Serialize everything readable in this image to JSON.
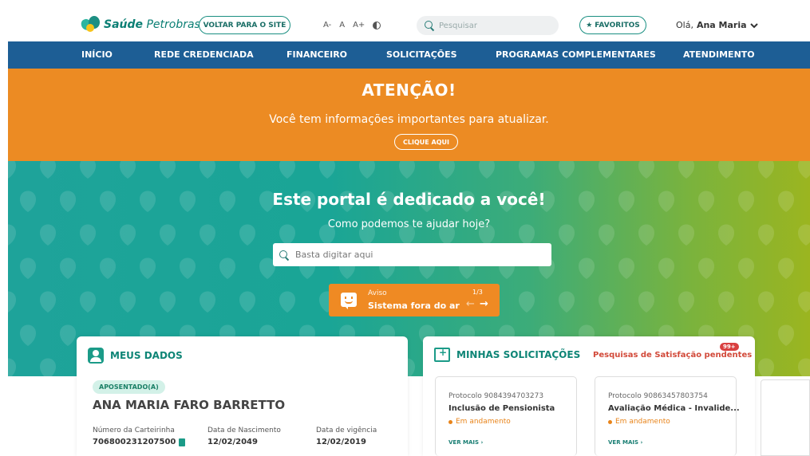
{
  "header": {
    "logo_bold": "Saúde",
    "logo_rest": "Petrobras",
    "back_button": "VOLTAR PARA O SITE",
    "font_decrease": "A-",
    "font_normal": "A",
    "font_increase": "A+",
    "search_placeholder": "Pesquisar",
    "favorites": "FAVORITOS",
    "greeting_prefix": "Olá,",
    "user_name": "Ana Maria"
  },
  "nav": {
    "items": [
      "INÍCIO",
      "REDE CREDENCIADA",
      "FINANCEIRO",
      "SOLICITAÇÕES",
      "PROGRAMAS COMPLEMENTARES",
      "ATENDIMENTO"
    ]
  },
  "alert": {
    "title": "ATENÇÃO!",
    "message": "Você tem informações importantes para atualizar.",
    "button": "CLIQUE AQUI"
  },
  "hero": {
    "title_prefix": "Este portal é dedicado a ",
    "title_emph": "você!",
    "subtitle": "Como podemos te ajudar hoje?",
    "search_placeholder": "Basta digitar aqui",
    "notice": {
      "label": "Aviso",
      "text": "Sistema fora do ar",
      "counter": "1/3"
    }
  },
  "meus_dados": {
    "title": "MEUS DADOS",
    "badge": "APOSENTADO(A)",
    "name": "ANA MARIA FARO BARRETTO",
    "fields": [
      {
        "label": "Número da Carteirinha",
        "value": "706800231207500"
      },
      {
        "label": "Data de Nascimento",
        "value": "12/02/2049"
      },
      {
        "label": "Data de vigência",
        "value": "12/02/2019"
      }
    ]
  },
  "solicitacoes": {
    "title": "MINHAS SOLICITAÇÕES",
    "survey_link": "Pesquisas de Satisfação pendentes",
    "survey_badge": "99+",
    "items": [
      {
        "protocol": "Protocolo 9084394703273",
        "title": "Inclusão de Pensionista",
        "status": "Em andamento",
        "more": "VER MAIS"
      },
      {
        "protocol": "Protocolo 90863457803754",
        "title": "Avaliação Médica - Invalide...",
        "status": "Em andamento",
        "more": "VER MAIS"
      }
    ]
  },
  "colors": {
    "nav": "#1d5e95",
    "alert": "#ec8b23",
    "hero_start": "#1ea39a",
    "hero_end": "#9bb520",
    "accent": "#0e8576"
  }
}
